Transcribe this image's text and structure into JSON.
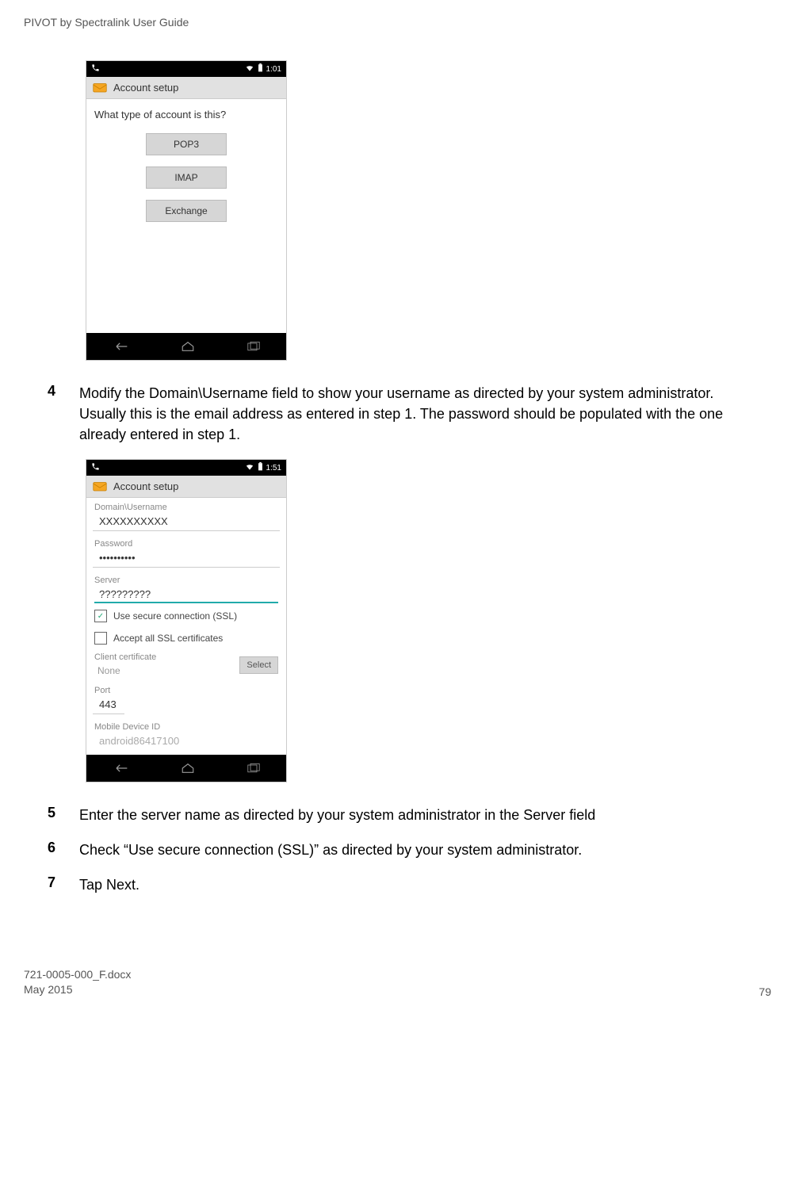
{
  "header_title": "PIVOT by Spectralink User Guide",
  "screenshot1": {
    "status_time": "1:01",
    "title": "Account setup",
    "prompt": "What type of account is this?",
    "buttons": [
      "POP3",
      "IMAP",
      "Exchange"
    ]
  },
  "steps": {
    "s4_num": "4",
    "s4_text": "Modify the Domain\\Username field to show your username as directed by your system administrator. Usually this is the email address as entered in step 1. The password should be populated with the one already entered in step 1.",
    "s5_num": "5",
    "s5_text": "Enter the server name as directed by your system administrator in the Server field",
    "s6_num": "6",
    "s6_text": "Check “Use secure connection (SSL)” as directed by your system administrator.",
    "s7_num": "7",
    "s7_text": "Tap Next."
  },
  "screenshot2": {
    "status_time": "1:51",
    "title": "Account setup",
    "domain_label": "Domain\\Username",
    "domain_value": "XXXXXXXXXX",
    "password_label": "Password",
    "password_value": "••••••••••",
    "server_label": "Server",
    "server_value": "?????????",
    "ssl_checkbox_label": "Use secure connection (SSL)",
    "ssl_checked": true,
    "accept_ssl_label": "Accept all SSL certificates",
    "accept_ssl_checked": false,
    "client_cert_label": "Client certificate",
    "client_cert_value": "None",
    "select_button": "Select",
    "port_label": "Port",
    "port_value": "443",
    "device_id_label": "Mobile Device ID",
    "device_id_value": "android86417100"
  },
  "footer": {
    "docname": "721-0005-000_F.docx",
    "date": "May 2015",
    "page": "79"
  }
}
